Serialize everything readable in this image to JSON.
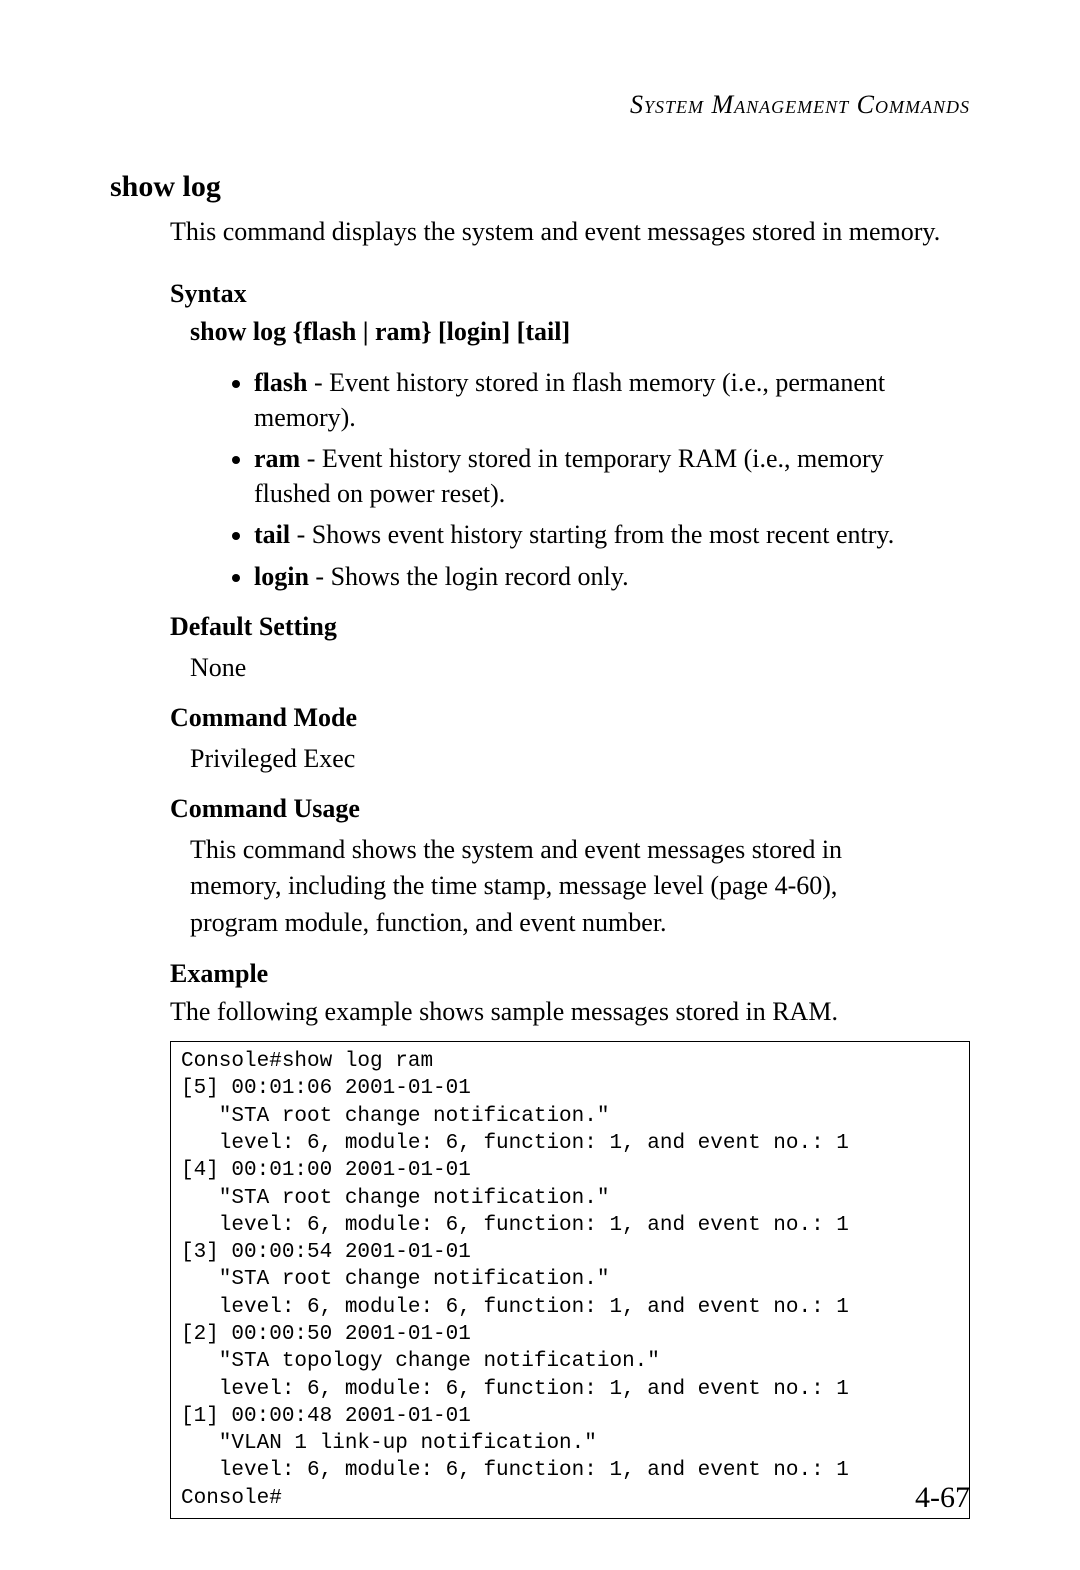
{
  "running_head": "System Management Commands",
  "command_title": "show log",
  "intro_text": "This command displays the system and event messages stored in memory.",
  "sections": {
    "syntax_label": "Syntax",
    "syntax_line": "show log {flash | ram} [login] [tail]",
    "bullets": [
      {
        "term": "flash",
        "desc": " - Event history stored in flash memory (i.e., permanent memory)."
      },
      {
        "term": "ram",
        "desc": " - Event history stored in temporary RAM (i.e., memory flushed on power reset)."
      },
      {
        "term": "tail",
        "desc": " - Shows event history starting from the most recent entry."
      },
      {
        "term": "login",
        "desc": " - Shows the login record only."
      }
    ],
    "default_label": "Default Setting",
    "default_value": "None",
    "mode_label": "Command Mode",
    "mode_value": "Privileged Exec",
    "usage_label": "Command Usage",
    "usage_text": "This command shows the system and event messages stored in memory, including the time stamp, message level (page 4-60), program module, function, and event number.",
    "example_label": "Example",
    "example_intro": "The following example shows sample messages stored in RAM."
  },
  "console_output": "Console#show log ram\n[5] 00:01:06 2001-01-01\n   \"STA root change notification.\"\n   level: 6, module: 6, function: 1, and event no.: 1\n[4] 00:01:00 2001-01-01\n   \"STA root change notification.\"\n   level: 6, module: 6, function: 1, and event no.: 1\n[3] 00:00:54 2001-01-01\n   \"STA root change notification.\"\n   level: 6, module: 6, function: 1, and event no.: 1\n[2] 00:00:50 2001-01-01\n   \"STA topology change notification.\"\n   level: 6, module: 6, function: 1, and event no.: 1\n[1] 00:00:48 2001-01-01\n   \"VLAN 1 link-up notification.\"\n   level: 6, module: 6, function: 1, and event no.: 1\nConsole#",
  "page_number": "4-67"
}
